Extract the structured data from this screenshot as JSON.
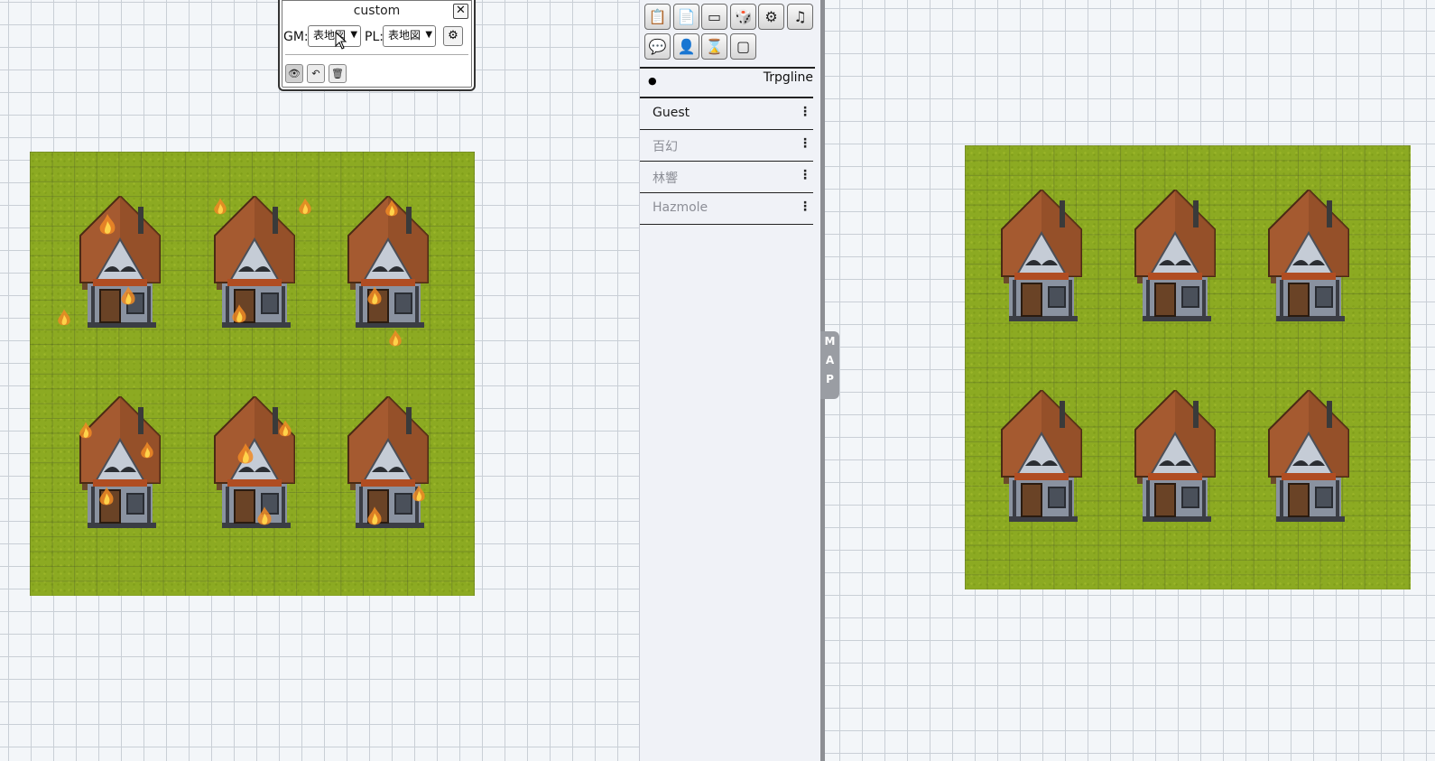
{
  "layer_window": {
    "title": "custom",
    "close_label": "✕",
    "gm_label": "GM:",
    "gm_value": "表地図",
    "pl_label": "PL:",
    "pl_value": "表地図"
  },
  "toolbar": {
    "icons": [
      "clipboard-check-icon",
      "clipboard-lock-icon",
      "portrait-frame-icon",
      "dice-icon",
      "gear-icon",
      "music-note-icon",
      "chat-bubble-icon",
      "user-silhouette-icon",
      "hourglass-icon",
      "map-frame-icon"
    ]
  },
  "side_panel": {
    "user_name": "Trpgline",
    "players": [
      {
        "name": "Guest",
        "color": "#1a1a1a"
      },
      {
        "name": "百幻",
        "color": "#8c8e96"
      },
      {
        "name": "林響",
        "color": "#8c8e96"
      },
      {
        "name": "Hazmole",
        "color": "#8c8e96"
      }
    ],
    "menu_glyph": "⋮"
  },
  "map_tab": {
    "letters": [
      "M",
      "A",
      "P"
    ]
  },
  "maps": {
    "left": {
      "houses_burning": true,
      "house_count": 6
    },
    "right": {
      "houses_burning": false,
      "house_count": 6
    }
  },
  "colors": {
    "grass": "#8caa22",
    "roof": "#a55a30",
    "wall": "#7d8593"
  }
}
